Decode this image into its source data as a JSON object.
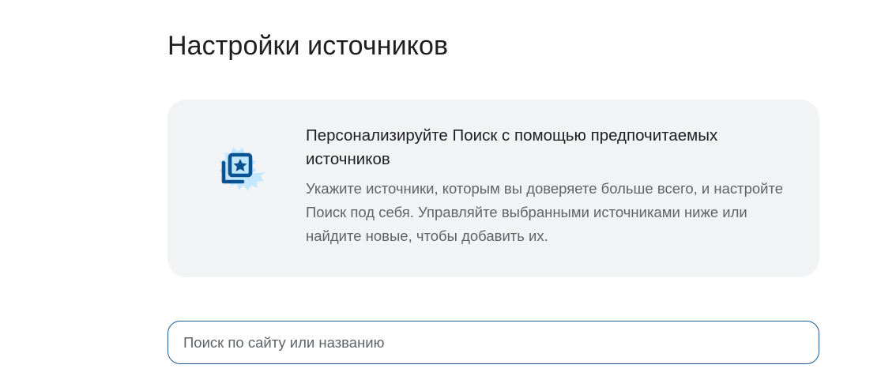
{
  "page": {
    "title": "Настройки источников"
  },
  "info_card": {
    "heading": "Персонализируйте Поиск с помощью предпочитаемых источников",
    "body": "Укажите источники, которым вы доверяете больше всего, и настройте Поиск под себя. Управляйте выбранными источниками ниже или найдите новые, чтобы добавить их.",
    "icon": "starred-sources-icon"
  },
  "search": {
    "placeholder": "Поиск по сайту или названию",
    "value": ""
  },
  "colors": {
    "badge_background": "#c2e7ff",
    "icon_color": "#0b5390",
    "card_background": "#f2f3f5",
    "search_border": "#1b5c99",
    "title_text": "#1f1f1f",
    "secondary_text": "#5f6368"
  }
}
